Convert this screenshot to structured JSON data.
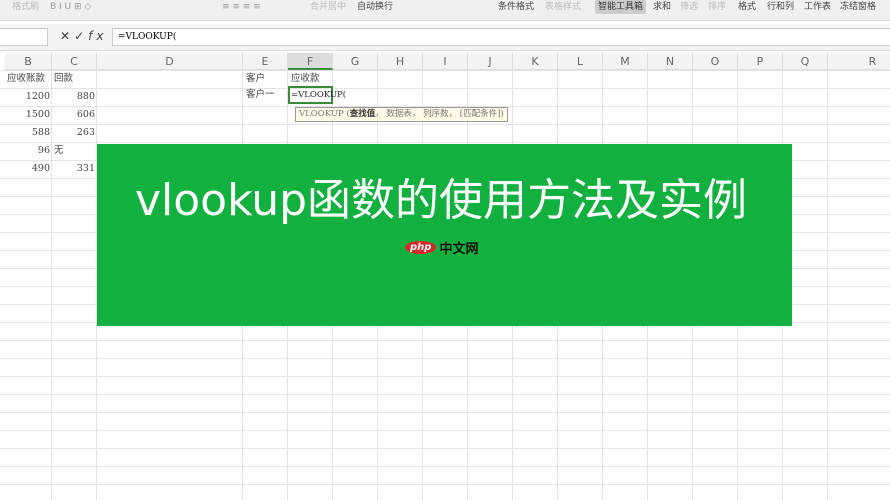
{
  "ribbon": {
    "left": [
      "格式刷",
      "合并居中",
      "自动换行"
    ],
    "right": [
      "条件格式",
      "表格样式",
      "智能工具箱",
      "求和",
      "筛选",
      "排序",
      "格式",
      "行和列",
      "工作表",
      "冻结窗格"
    ]
  },
  "formula_bar": {
    "fx_label": "fx",
    "formula": "=VLOOKUP("
  },
  "columns": [
    "B",
    "C",
    "D",
    "E",
    "F",
    "G",
    "H",
    "I",
    "J",
    "K",
    "L",
    "M",
    "N",
    "O",
    "P",
    "Q",
    "R"
  ],
  "selected_column": "F",
  "table": {
    "headers": [
      "应收账款",
      "回款"
    ],
    "rows": [
      [
        "1200",
        "880"
      ],
      [
        "1500",
        "606"
      ],
      [
        "588",
        "263"
      ],
      [
        "96",
        "无"
      ],
      [
        "490",
        "331"
      ]
    ]
  },
  "lookup": {
    "e1": "客户",
    "f1": "应收款",
    "e2": "客户一",
    "f2": "=VLOOKUP("
  },
  "tooltip": {
    "func": "VLOOKUP",
    "arg1": "查找值",
    "rest": "， 数据表， 列序数， [匹配条件])"
  },
  "banner": {
    "title": "vlookup函数的使用方法及实例",
    "color": "#12b03f",
    "watermark": "php中文网"
  }
}
